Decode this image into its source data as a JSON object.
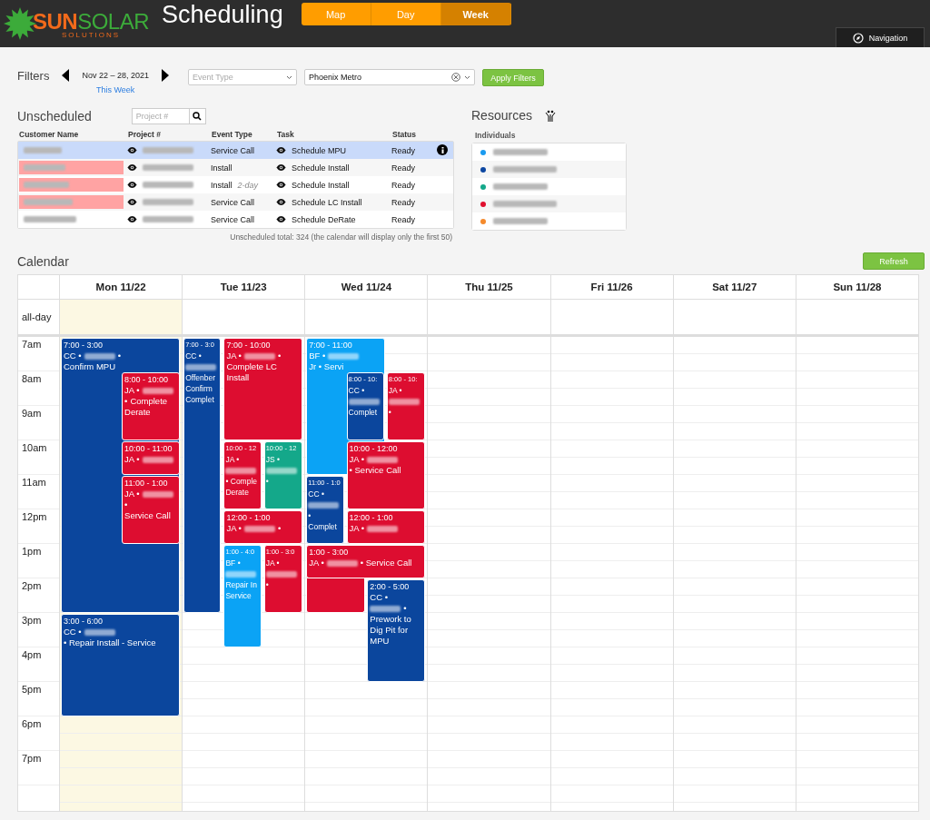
{
  "header": {
    "logo": {
      "part1": "SUN",
      "part2": "SOLAR",
      "tagline": "SOLUTIONS"
    },
    "title": "Scheduling",
    "tabs": [
      {
        "label": "Map",
        "selected": false
      },
      {
        "label": "Day",
        "selected": false
      },
      {
        "label": "Week",
        "selected": true
      }
    ],
    "nav_button": "Navigation"
  },
  "filters": {
    "label": "Filters",
    "range": "Nov 22 – 28, 2021",
    "this_week": "This Week",
    "event_type": {
      "placeholder": "Event Type"
    },
    "region": {
      "value": "Phoenix Metro"
    },
    "apply": "Apply Filters"
  },
  "unscheduled": {
    "title": "Unscheduled",
    "search": {
      "placeholder": "Project #"
    },
    "columns": [
      "Customer Name",
      "Project #",
      "Event Type",
      "Task",
      "Status"
    ],
    "rows": [
      {
        "selected": true,
        "flagged": false,
        "event_type": "Service Call",
        "task": "Schedule MPU",
        "status": "Ready"
      },
      {
        "selected": false,
        "flagged": true,
        "event_type": "Install",
        "task": "Schedule Install",
        "status": "Ready"
      },
      {
        "selected": false,
        "flagged": true,
        "event_type": "Install",
        "note": "2-day",
        "task": "Schedule Install",
        "status": "Ready"
      },
      {
        "selected": false,
        "flagged": true,
        "event_type": "Service Call",
        "task": "Schedule LC Install",
        "status": "Ready"
      },
      {
        "selected": false,
        "flagged": false,
        "event_type": "Service Call",
        "task": "Schedule DeRate",
        "status": "Ready"
      }
    ],
    "total": "Unscheduled total: 324  (the calendar will display only the first 50)"
  },
  "resources": {
    "title": "Resources",
    "group": "Individuals",
    "items": [
      {
        "color": "#1a9bf0"
      },
      {
        "color": "#0d47a1"
      },
      {
        "color": "#14a88a"
      },
      {
        "color": "#e0102f"
      },
      {
        "color": "#f58a2c"
      }
    ]
  },
  "calendar": {
    "title": "Calendar",
    "refresh": "Refresh",
    "all_day": "all-day",
    "hours": [
      "7am",
      "8am",
      "9am",
      "10am",
      "11am",
      "12pm",
      "1pm",
      "2pm",
      "3pm",
      "4pm",
      "5pm",
      "6pm",
      "7pm"
    ],
    "days": [
      {
        "label": "Mon 11/22",
        "today": true,
        "events": [
          {
            "color": "#0b469d",
            "time": "7:00 - 3:00",
            "parts": [
              {
                "kind": "text",
                "text": "CC •"
              },
              {
                "kind": "redacted"
              },
              {
                "kind": "text",
                "text": "•"
              },
              {
                "kind": "text",
                "text": "Confirm MPU"
              }
            ]
          },
          {
            "color": "#dd0d30",
            "time": "8:00 - 10:00",
            "parts": [
              {
                "kind": "text",
                "text": "JA •"
              },
              {
                "kind": "redacted"
              },
              {
                "kind": "text",
                "text": "•"
              },
              {
                "kind": "text",
                "text": "Complete"
              },
              {
                "kind": "text",
                "text": "Derate"
              }
            ]
          },
          {
            "color": "#dd0d30",
            "time": "10:00 - 11:00",
            "parts": [
              {
                "kind": "text",
                "text": "JA •"
              },
              {
                "kind": "redacted"
              }
            ]
          },
          {
            "color": "#dd0d30",
            "time": "11:00 - 1:00",
            "parts": [
              {
                "kind": "text",
                "text": "JA •"
              },
              {
                "kind": "redacted"
              },
              {
                "kind": "text",
                "text": "•"
              },
              {
                "kind": "text",
                "text": "Service Call"
              }
            ]
          },
          {
            "color": "#0b469d",
            "time": "3:00 - 6:00",
            "parts": [
              {
                "kind": "text",
                "text": "CC •"
              },
              {
                "kind": "redacted"
              },
              {
                "kind": "text",
                "text": "• Repair Install - Service"
              }
            ]
          }
        ]
      },
      {
        "label": "Tue 11/23",
        "today": false,
        "events": [
          {
            "color": "#0b469d",
            "time": "7:00 - 3:0",
            "parts": [
              {
                "kind": "text",
                "text": "CC •"
              },
              {
                "kind": "redacted"
              },
              {
                "kind": "text",
                "text": "Offenber"
              },
              {
                "kind": "text",
                "text": "Confirm"
              },
              {
                "kind": "text",
                "text": "Complet"
              }
            ]
          },
          {
            "color": "#dd0d30",
            "time": "7:00 - 10:00",
            "parts": [
              {
                "kind": "text",
                "text": "JA •"
              },
              {
                "kind": "redacted"
              },
              {
                "kind": "text",
                "text": "•"
              },
              {
                "kind": "text",
                "text": "Complete LC"
              },
              {
                "kind": "text",
                "text": "Install"
              }
            ]
          },
          {
            "color": "#dd0d30",
            "time": "10:00 - 12",
            "parts": [
              {
                "kind": "text",
                "text": "JA •"
              },
              {
                "kind": "redacted"
              },
              {
                "kind": "text",
                "text": "• Comple"
              },
              {
                "kind": "text",
                "text": "Derate"
              }
            ]
          },
          {
            "color": "#14a88a",
            "time": "10:00 - 12",
            "parts": [
              {
                "kind": "text",
                "text": "JS •"
              },
              {
                "kind": "redacted"
              },
              {
                "kind": "text",
                "text": "•"
              }
            ]
          },
          {
            "color": "#dd0d30",
            "time": "12:00 - 1:00",
            "parts": [
              {
                "kind": "text",
                "text": "JA •"
              },
              {
                "kind": "redacted"
              },
              {
                "kind": "text",
                "text": "•"
              }
            ]
          },
          {
            "color": "#0ba3f5",
            "time": "1:00 - 4:0",
            "parts": [
              {
                "kind": "text",
                "text": "BF •"
              },
              {
                "kind": "redacted"
              },
              {
                "kind": "text",
                "text": "Repair In"
              },
              {
                "kind": "text",
                "text": "Service"
              }
            ]
          },
          {
            "color": "#dd0d30",
            "time": "1:00 - 3:0",
            "parts": [
              {
                "kind": "text",
                "text": "JA •"
              },
              {
                "kind": "redacted"
              },
              {
                "kind": "text",
                "text": "•"
              }
            ]
          }
        ]
      },
      {
        "label": "Wed 11/24",
        "today": false,
        "events": [
          {
            "color": "#0ba3f5",
            "time": "7:00 - 11:00",
            "parts": [
              {
                "kind": "text",
                "text": "BF •"
              },
              {
                "kind": "redacted"
              },
              {
                "kind": "text",
                "text": "Jr • Servi"
              }
            ]
          },
          {
            "color": "#0b469d",
            "time": "8:00 - 10:",
            "parts": [
              {
                "kind": "text",
                "text": "CC •"
              },
              {
                "kind": "redacted"
              },
              {
                "kind": "text",
                "text": "Complet"
              }
            ]
          },
          {
            "color": "#dd0d30",
            "time": "8:00 - 10:",
            "parts": [
              {
                "kind": "text",
                "text": "JA •"
              },
              {
                "kind": "redacted"
              },
              {
                "kind": "text",
                "text": "•"
              }
            ]
          },
          {
            "color": "#dd0d30",
            "time": "10:00 - 12:00",
            "parts": [
              {
                "kind": "text",
                "text": "JA •"
              },
              {
                "kind": "redacted"
              },
              {
                "kind": "text",
                "text": "• Service"
              },
              {
                "kind": "text",
                "text": "Call"
              }
            ]
          },
          {
            "color": "#0b469d",
            "time": "11:00 - 1:0",
            "parts": [
              {
                "kind": "text",
                "text": "CC •"
              },
              {
                "kind": "redacted"
              },
              {
                "kind": "text",
                "text": "•"
              },
              {
                "kind": "text",
                "text": "Complet"
              }
            ]
          },
          {
            "color": "#dd0d30",
            "time": "12:00 - 1:00",
            "parts": [
              {
                "kind": "text",
                "text": "JA •"
              },
              {
                "kind": "redacted"
              }
            ]
          },
          {
            "color": "#dd0d30",
            "time": "1:00 - 3:00",
            "parts": [
              {
                "kind": "text",
                "text": "JA •"
              },
              {
                "kind": "redacted"
              },
              {
                "kind": "text",
                "text": "• Service Call"
              }
            ]
          },
          {
            "color": "#0b469d",
            "time": "2:00 - 5:00",
            "parts": [
              {
                "kind": "text",
                "text": "CC •"
              },
              {
                "kind": "redacted"
              },
              {
                "kind": "text",
                "text": "•"
              },
              {
                "kind": "text",
                "text": "Prework to"
              },
              {
                "kind": "text",
                "text": "Dig Pit for"
              },
              {
                "kind": "text",
                "text": "MPU"
              }
            ]
          }
        ]
      },
      {
        "label": "Thu 11/25",
        "today": false
      },
      {
        "label": "Fri 11/26",
        "today": false
      },
      {
        "label": "Sat 11/27",
        "today": false
      },
      {
        "label": "Sun 11/28",
        "today": false
      }
    ]
  }
}
